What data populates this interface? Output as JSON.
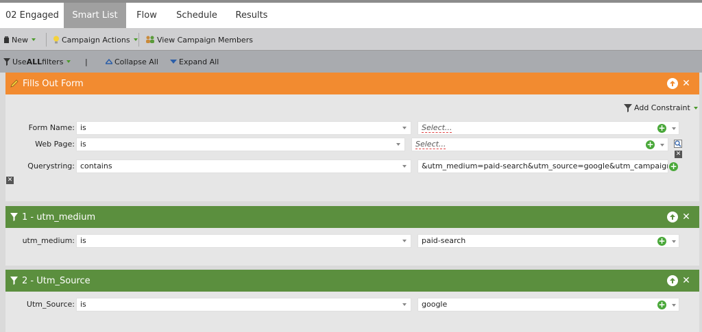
{
  "tabs": [
    {
      "label": "02 Engaged",
      "active": false
    },
    {
      "label": "Smart List",
      "active": true
    },
    {
      "label": "Flow",
      "active": false
    },
    {
      "label": "Schedule",
      "active": false
    },
    {
      "label": "Results",
      "active": false
    }
  ],
  "toolbar": {
    "new_label": "New",
    "campaign_actions_label": "Campaign Actions",
    "view_members_label": "View Campaign Members"
  },
  "filterbar": {
    "use_prefix": "Use ",
    "use_bold": "ALL",
    "use_suffix": " filters",
    "separator": "|",
    "collapse_label": "Collapse All",
    "expand_label": "Expand All"
  },
  "filters": [
    {
      "title": "Fills Out Form",
      "color": "#f28b30",
      "add_constraint_label": "Add Constraint",
      "rows": [
        {
          "label": "Form Name:",
          "operator": "is",
          "value": "Select..."
        },
        {
          "label": "Web Page:",
          "operator": "is",
          "value": "Select..."
        },
        {
          "label": "Querystring:",
          "operator": "contains",
          "value": "&utm_medium=paid-search&utm_source=google&utm_campaign=te"
        }
      ]
    },
    {
      "title": "1 - utm_medium",
      "color": "#5b8f3e",
      "rows": [
        {
          "label": "utm_medium:",
          "operator": "is",
          "value": "paid-search"
        }
      ]
    },
    {
      "title": "2 - Utm_Source",
      "color": "#5b8f3e",
      "rows": [
        {
          "label": "Utm_Source:",
          "operator": "is",
          "value": "google"
        }
      ]
    }
  ]
}
